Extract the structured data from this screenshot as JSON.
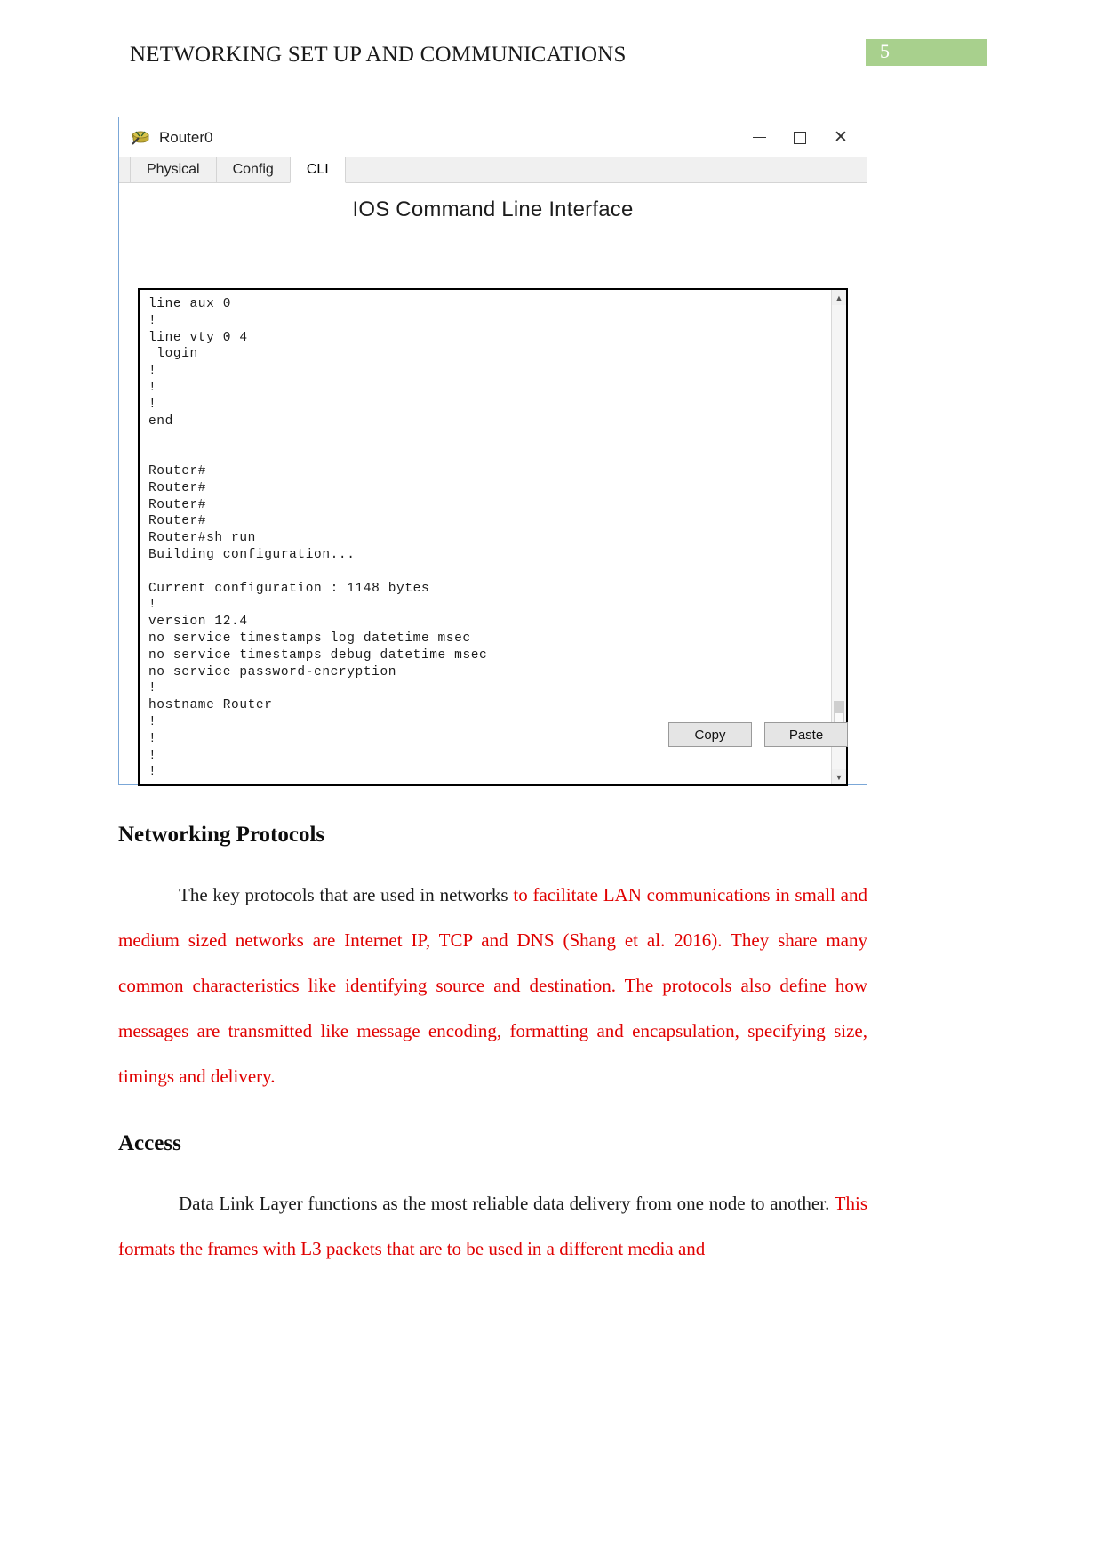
{
  "header": {
    "title": "NETWORKING SET UP AND COMMUNICATIONS",
    "page_number": "5",
    "badge_color": "#a8d08d"
  },
  "packet_tracer_window": {
    "title": "Router0",
    "icon": "router-icon",
    "window_controls": {
      "minimize": "minimize-icon",
      "maximize": "maximize-icon",
      "close": "✕"
    },
    "tabs": [
      {
        "label": "Physical",
        "active": false
      },
      {
        "label": "Config",
        "active": false
      },
      {
        "label": "CLI",
        "active": true
      }
    ],
    "panel_heading": "IOS Command Line Interface",
    "terminal_lines": [
      "line aux 0",
      "!",
      "line vty 0 4",
      " login",
      "!",
      "!",
      "!",
      "end",
      "",
      "",
      "Router#",
      "Router#",
      "Router#",
      "Router#",
      "Router#sh run",
      "Building configuration...",
      "",
      "Current configuration : 1148 bytes",
      "!",
      "version 12.4",
      "no service timestamps log datetime msec",
      "no service timestamps debug datetime msec",
      "no service password-encryption",
      "!",
      "hostname Router",
      "!",
      "!",
      "!",
      "!"
    ],
    "scrollbar": {
      "up_arrow": "▲",
      "down_arrow": "▼"
    },
    "buttons": {
      "copy": "Copy",
      "paste": "Paste"
    }
  },
  "document": {
    "sections": [
      {
        "heading": "Networking Protocols",
        "paragraph_black_1": "The key protocols that are used in networks ",
        "paragraph_red_1": "to facilitate LAN communications in small and medium sized networks are Internet IP, TCP and DNS (Shang et al. 2016). They share many common characteristics like identifying source and destination. The protocols also define how messages are transmitted like message encoding, formatting and encapsulation, specifying size, timings and delivery."
      },
      {
        "heading": "Access",
        "paragraph_black_1": "Data Link Layer functions as the most reliable data delivery from one node to another. ",
        "paragraph_red_1": "This formats the frames with L3 packets that are to be used in a different media and"
      }
    ]
  }
}
